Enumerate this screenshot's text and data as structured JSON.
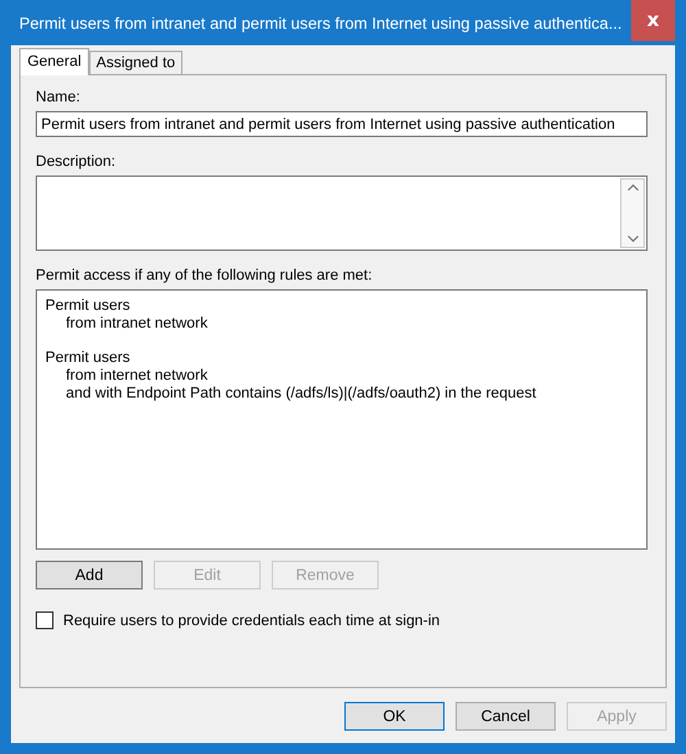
{
  "window": {
    "title": "Permit users from intranet and permit users from Internet using passive authentica...",
    "close": "x"
  },
  "tabs": [
    {
      "label": "General",
      "selected": true
    },
    {
      "label": "Assigned to",
      "selected": false
    }
  ],
  "name_field": {
    "label": "Name:",
    "value": "Permit users from intranet and permit users from Internet using passive authentication"
  },
  "description_field": {
    "label": "Description:"
  },
  "rules": {
    "label": "Permit access if any of the following rules are met:",
    "items": [
      {
        "title": "Permit users",
        "conditions": [
          "from intranet network"
        ]
      },
      {
        "title": "Permit users",
        "conditions": [
          "from internet network",
          "and with Endpoint Path contains (/adfs/ls)|(/adfs/oauth2) in the request"
        ]
      }
    ]
  },
  "rule_buttons": [
    {
      "label": "Add",
      "disabled": false
    },
    {
      "label": "Edit",
      "disabled": true
    },
    {
      "label": "Remove",
      "disabled": true
    }
  ],
  "require_credentials": {
    "label": "Require users to provide credentials each time at sign-in",
    "checked": false
  },
  "dialog_buttons": [
    {
      "label": "OK",
      "disabled": false,
      "default": true
    },
    {
      "label": "Cancel",
      "disabled": false,
      "default": false
    },
    {
      "label": "Apply",
      "disabled": true,
      "default": false
    }
  ]
}
